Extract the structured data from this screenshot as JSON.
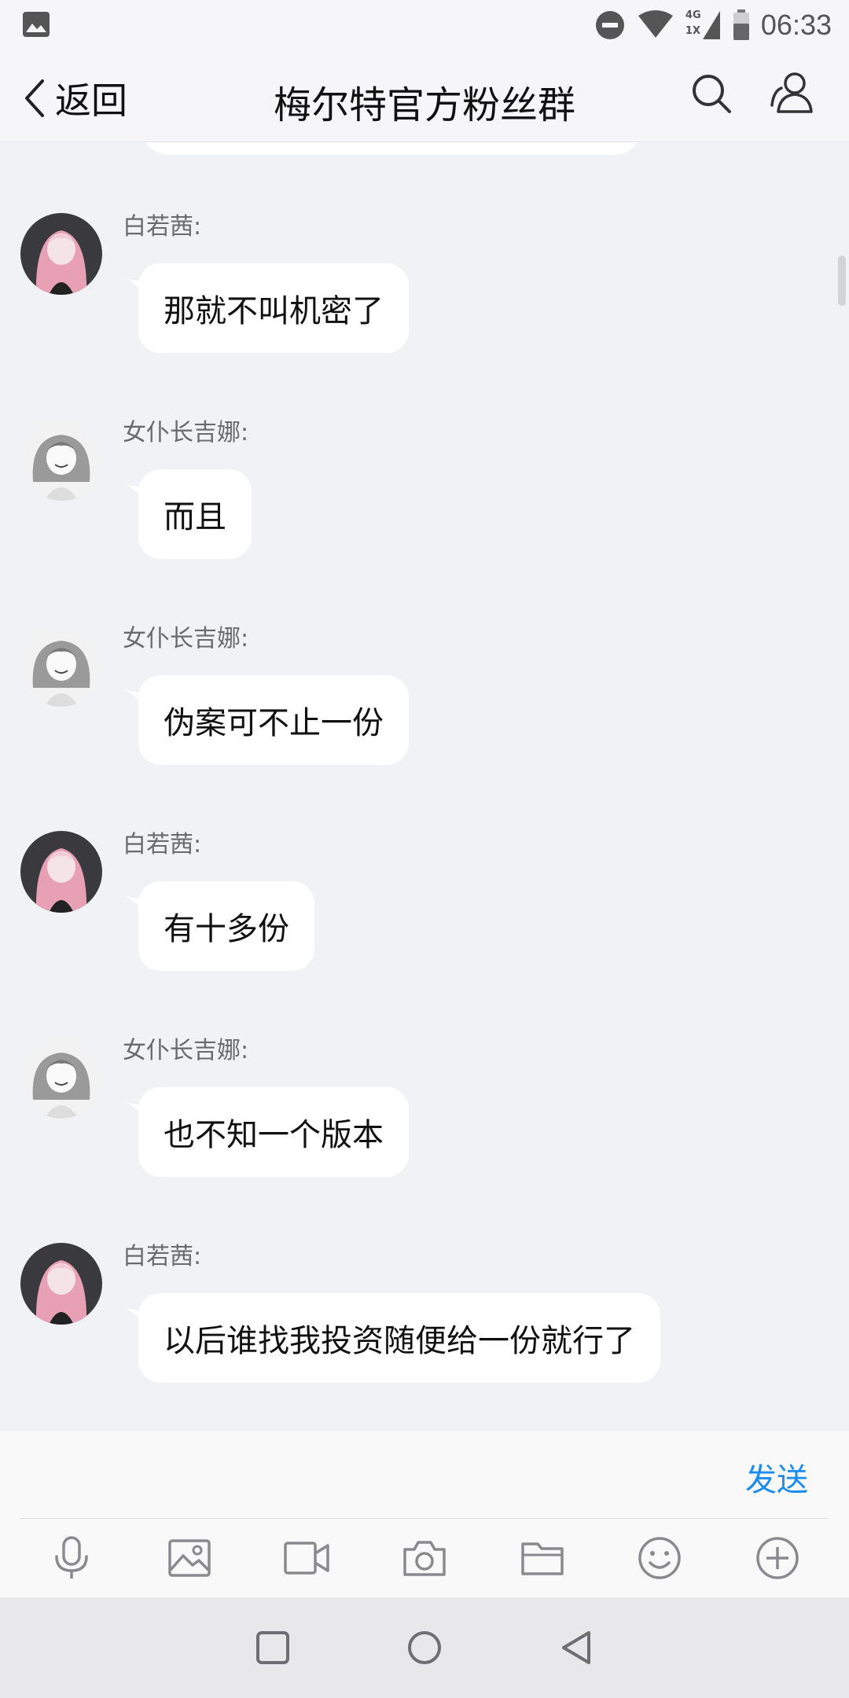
{
  "status_bar": {
    "time": "06:33",
    "network": "4G",
    "network2": "1X",
    "icons": [
      "gallery-icon",
      "do-not-disturb-icon",
      "wifi-icon",
      "signal-icon",
      "battery-icon"
    ]
  },
  "header": {
    "back_label": "返回",
    "title": "梅尔特官方粉丝群",
    "icons": [
      "back-chevron-icon",
      "search-icon",
      "group-members-icon"
    ]
  },
  "messages": [
    {
      "sender": "白若茜:",
      "text": "那就不叫机密了",
      "avatar": "pink-hair-avatar"
    },
    {
      "sender": "女仆长吉娜:",
      "text": "而且",
      "avatar": "maid-avatar"
    },
    {
      "sender": "女仆长吉娜:",
      "text": "伪案可不止一份",
      "avatar": "maid-avatar"
    },
    {
      "sender": "白若茜:",
      "text": "有十多份",
      "avatar": "pink-hair-avatar"
    },
    {
      "sender": "女仆长吉娜:",
      "text": "也不知一个版本",
      "avatar": "maid-avatar"
    },
    {
      "sender": "白若茜:",
      "text": "以后谁找我投资随便给一份就行了",
      "avatar": "pink-hair-avatar"
    }
  ],
  "input": {
    "send_label": "发送"
  },
  "toolbar": {
    "icons": [
      "microphone-icon",
      "image-icon",
      "video-icon",
      "camera-icon",
      "folder-icon",
      "emoji-icon",
      "plus-icon"
    ]
  },
  "nav": {
    "icons": [
      "recent-apps-icon",
      "home-icon",
      "back-icon"
    ]
  },
  "colors": {
    "accent": "#1b8cf0",
    "background": "#f1f2f5",
    "bubble": "#ffffff",
    "avatar_pink": "#e8a0b4"
  }
}
